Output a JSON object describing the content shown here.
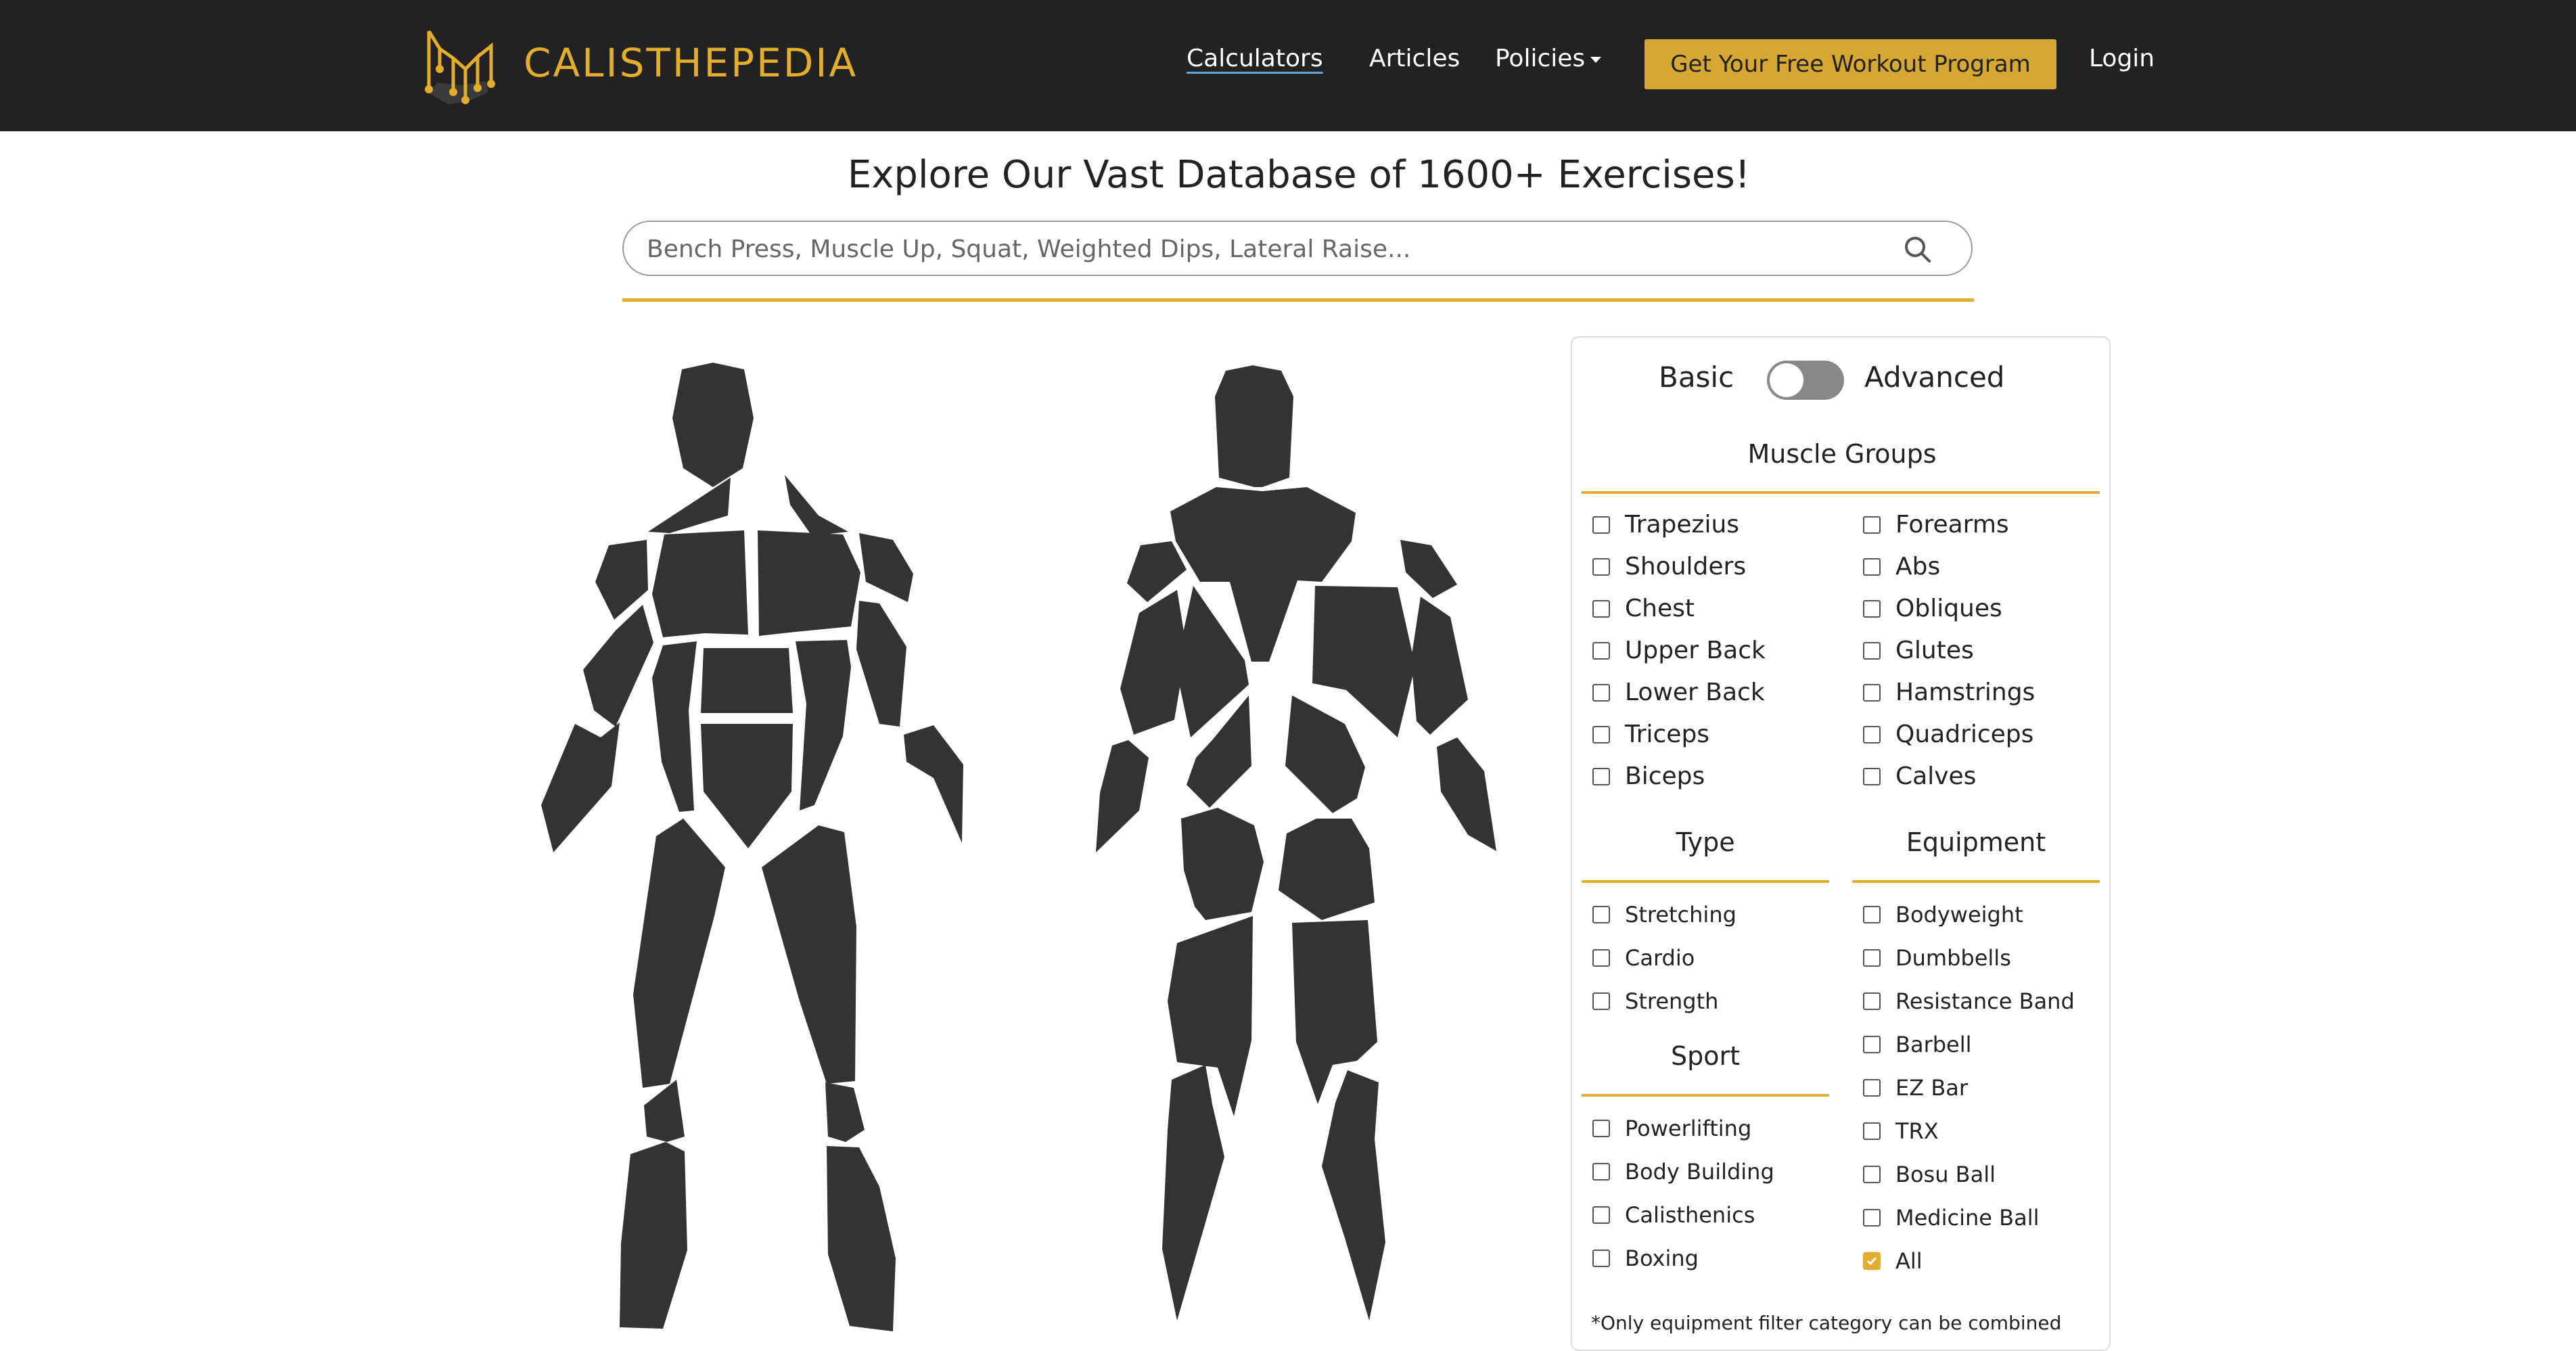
{
  "nav": {
    "logo_text": "CALISTHEPEDIA",
    "links": [
      "Calculators",
      "Articles",
      "Policies"
    ],
    "cta": "Get Your Free Workout Program",
    "login": "Login"
  },
  "main": {
    "title": "Explore Our Vast Database of 1600+ Exercises!",
    "search_placeholder": "Bench Press, Muscle Up, Squat, Weighted Dips, Lateral Raise..."
  },
  "filters": {
    "toggle_left": "Basic",
    "toggle_right": "Advanced",
    "toggle_advanced_on": false,
    "muscle_groups_title": "Muscle Groups",
    "muscle_groups_left": [
      "Trapezius",
      "Shoulders",
      "Chest",
      "Upper Back",
      "Lower Back",
      "Triceps",
      "Biceps"
    ],
    "muscle_groups_right": [
      "Forearms",
      "Abs",
      "Obliques",
      "Glutes",
      "Hamstrings",
      "Quadriceps",
      "Calves"
    ],
    "type_title": "Type",
    "type_items": [
      "Stretching",
      "Cardio",
      "Strength"
    ],
    "sport_title": "Sport",
    "sport_items": [
      "Powerlifting",
      "Body Building",
      "Calisthenics",
      "Boxing"
    ],
    "equipment_title": "Equipment",
    "equipment_items": [
      "Bodyweight",
      "Dumbbells",
      "Resistance Band",
      "Barbell",
      "EZ Bar",
      "TRX",
      "Bosu Ball",
      "Medicine Ball",
      "All"
    ],
    "equipment_checked": [
      "All"
    ],
    "note": "*Only equipment filter category can be combined"
  },
  "colors": {
    "nav_bg": "#222222",
    "accent": "#e3ae2e",
    "cta_bg": "#d6a733",
    "body_figure": "#333333"
  }
}
